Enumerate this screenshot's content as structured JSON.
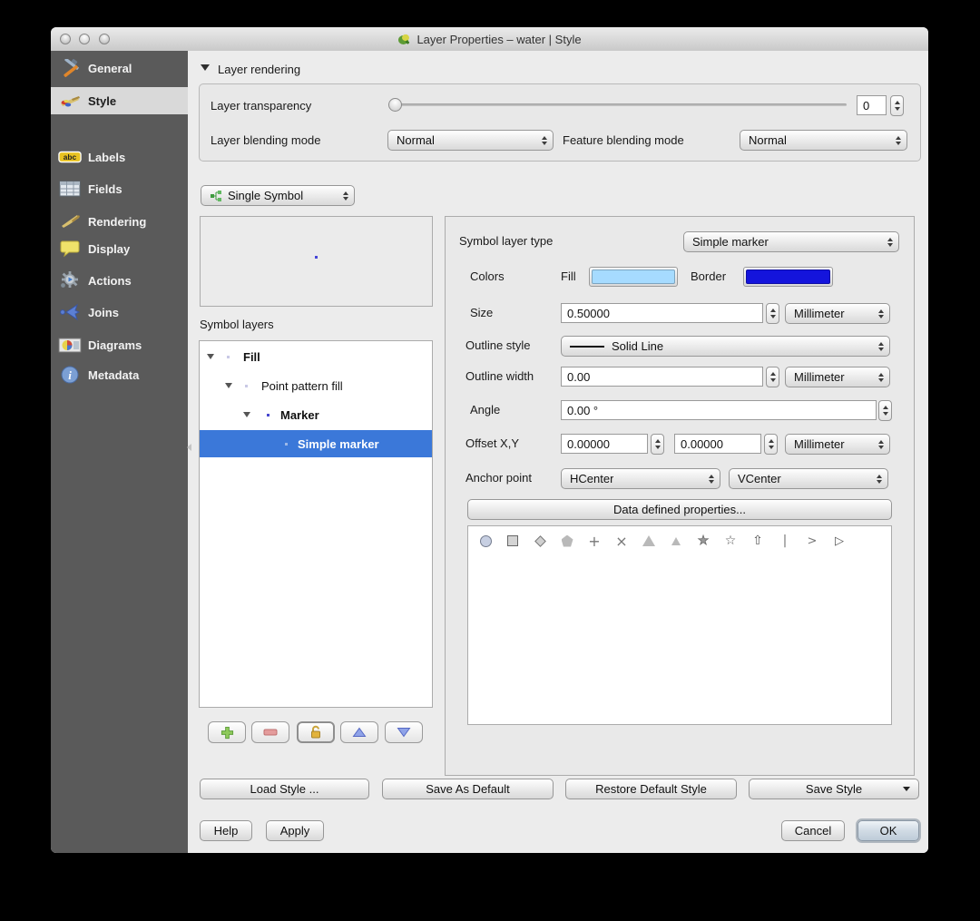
{
  "window": {
    "title": "Layer Properties – water | Style"
  },
  "sidebar": {
    "selected": "Style",
    "items": [
      {
        "label": "General"
      },
      {
        "label": "Style"
      },
      {
        "label": "Labels"
      },
      {
        "label": "Fields"
      },
      {
        "label": "Rendering"
      },
      {
        "label": "Display"
      },
      {
        "label": "Actions"
      },
      {
        "label": "Joins"
      },
      {
        "label": "Diagrams"
      },
      {
        "label": "Metadata"
      }
    ]
  },
  "layer_rendering": {
    "header": "Layer rendering",
    "transparency_label": "Layer transparency",
    "transparency_value": "0",
    "layer_blending_label": "Layer blending mode",
    "layer_blending_value": "Normal",
    "feature_blending_label": "Feature blending mode",
    "feature_blending_value": "Normal"
  },
  "renderer": {
    "value": "Single Symbol"
  },
  "symbol_layers": {
    "label": "Symbol layers",
    "selected": "Simple marker",
    "items": [
      {
        "label": "Fill"
      },
      {
        "label": "Point pattern fill"
      },
      {
        "label": "Marker"
      },
      {
        "label": "Simple marker"
      }
    ]
  },
  "properties": {
    "symbol_layer_type_label": "Symbol layer type",
    "symbol_layer_type_value": "Simple marker",
    "colors_label": "Colors",
    "fill_label": "Fill",
    "fill_color": "#a6dbff",
    "border_label": "Border",
    "border_color": "#1414dc",
    "size_label": "Size",
    "size_value": "0.50000",
    "size_unit": "Millimeter",
    "outline_style_label": "Outline style",
    "outline_style_value": "Solid Line",
    "outline_width_label": "Outline width",
    "outline_width_value": "0.00",
    "outline_width_unit": "Millimeter",
    "angle_label": "Angle",
    "angle_value": "0.00 °",
    "offset_label": "Offset X,Y",
    "offset_x_value": "0.00000",
    "offset_y_value": "0.00000",
    "offset_unit": "Millimeter",
    "anchor_label": "Anchor point",
    "anchor_h_value": "HCenter",
    "anchor_v_value": "VCenter",
    "data_defined_label": "Data defined properties..."
  },
  "shapes": {
    "names": [
      "circle",
      "square",
      "diamond",
      "pentagon",
      "cross",
      "cross2",
      "triangle",
      "equilateral-triangle",
      "regular-star",
      "star",
      "arrow",
      "line",
      "arrowhead",
      "filled-arrowhead"
    ]
  },
  "style_buttons": {
    "load": "Load Style ...",
    "save_as_default": "Save As Default",
    "restore_default": "Restore Default Style",
    "save_style": "Save Style"
  },
  "dialog_buttons": {
    "help": "Help",
    "apply": "Apply",
    "cancel": "Cancel",
    "ok": "OK"
  }
}
